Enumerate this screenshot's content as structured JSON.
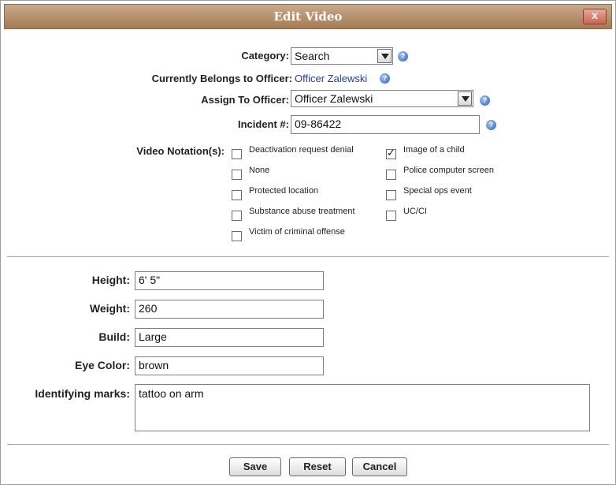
{
  "dialog": {
    "title": "Edit Video",
    "close_label": "x"
  },
  "form": {
    "category": {
      "label": "Category:",
      "value": "Search"
    },
    "belongs": {
      "label": "Currently Belongs to Officer:",
      "value": "Officer Zalewski"
    },
    "assign": {
      "label": "Assign To Officer:",
      "value": "Officer Zalewski"
    },
    "incident": {
      "label": "Incident #:",
      "value": "09-86422"
    },
    "notations": {
      "label": "Video Notation(s):",
      "items": [
        {
          "label": "Deactivation request denial",
          "checked": false
        },
        {
          "label": "Image of a child",
          "checked": true
        },
        {
          "label": "None",
          "checked": false
        },
        {
          "label": "Police computer screen",
          "checked": false
        },
        {
          "label": "Protected location",
          "checked": false
        },
        {
          "label": "Special ops event",
          "checked": false
        },
        {
          "label": "Substance abuse treatment",
          "checked": false
        },
        {
          "label": "UC/CI",
          "checked": false
        },
        {
          "label": "Victim of criminal offense",
          "checked": false
        }
      ]
    },
    "height": {
      "label": "Height:",
      "value": "6' 5\""
    },
    "weight": {
      "label": "Weight:",
      "value": "260"
    },
    "build": {
      "label": "Build:",
      "value": "Large"
    },
    "eye_color": {
      "label": "Eye Color:",
      "value": "brown"
    },
    "marks": {
      "label": "Identifying marks:",
      "value": "tattoo on arm"
    }
  },
  "buttons": {
    "save": "Save",
    "reset": "Reset",
    "cancel": "Cancel"
  },
  "icons": {
    "help": "help-icon",
    "checkmark": "checkmark-icon"
  },
  "colors": {
    "titlebar": "#b08a66",
    "link": "#1f3fa6"
  }
}
